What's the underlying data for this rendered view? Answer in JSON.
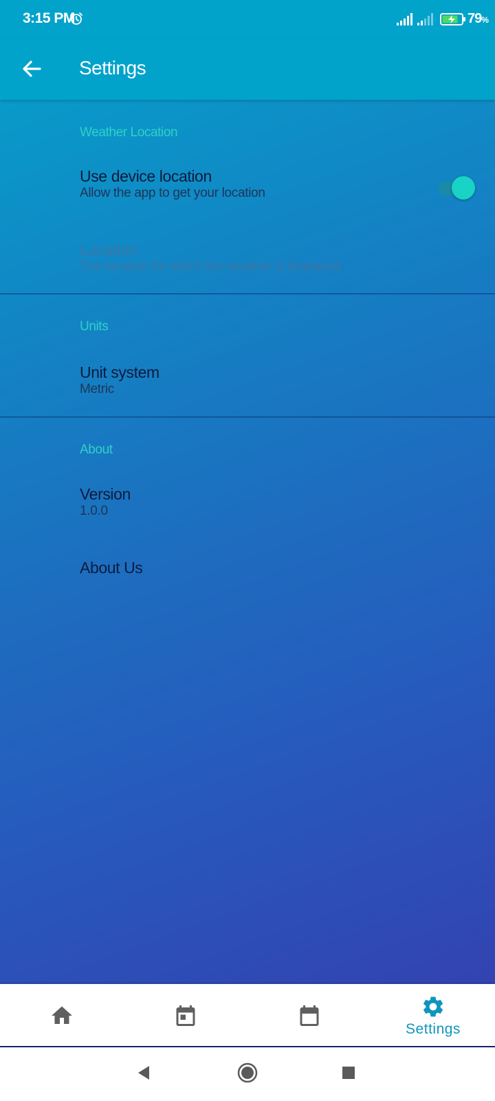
{
  "status_bar": {
    "time": "3:15 PM",
    "alarm_icon": "alarm-clock-icon",
    "signal_icons": [
      "signal-strength-icon",
      "signal-strength-weak-icon"
    ],
    "battery_icon": "battery-charging-icon",
    "battery_percent": "79",
    "battery_unit": "%"
  },
  "app_bar": {
    "back_icon": "arrow-back-icon",
    "title": "Settings"
  },
  "sections": {
    "weather_location": {
      "header": "Weather Location",
      "use_device_location": {
        "title": "Use device location",
        "summary": "Allow the app to get your location",
        "enabled": true
      },
      "location": {
        "title": "Location",
        "summary": "The location for which the weather is displayed",
        "disabled": true
      }
    },
    "units": {
      "header": "Units",
      "unit_system": {
        "title": "Unit system",
        "summary": "Metric"
      }
    },
    "about": {
      "header": "About",
      "version": {
        "title": "Version",
        "summary": "1.0.0"
      },
      "about_us": {
        "title": "About Us"
      }
    }
  },
  "bottom_nav": {
    "items": [
      {
        "icon": "home-icon",
        "label": "",
        "active": false
      },
      {
        "icon": "calendar-today-icon",
        "label": "",
        "active": false
      },
      {
        "icon": "calendar-week-icon",
        "label": "",
        "active": false
      },
      {
        "icon": "gear-icon",
        "label": "Settings",
        "active": true
      }
    ]
  },
  "system_nav": {
    "back": "triangle-back-icon",
    "home": "circle-home-icon",
    "recents": "square-recents-icon"
  },
  "colors": {
    "accent": "#2fd1c9",
    "app_bar": "#01a3cb",
    "nav_active": "#0e95bd",
    "nav_inactive": "#5f5f5f"
  }
}
